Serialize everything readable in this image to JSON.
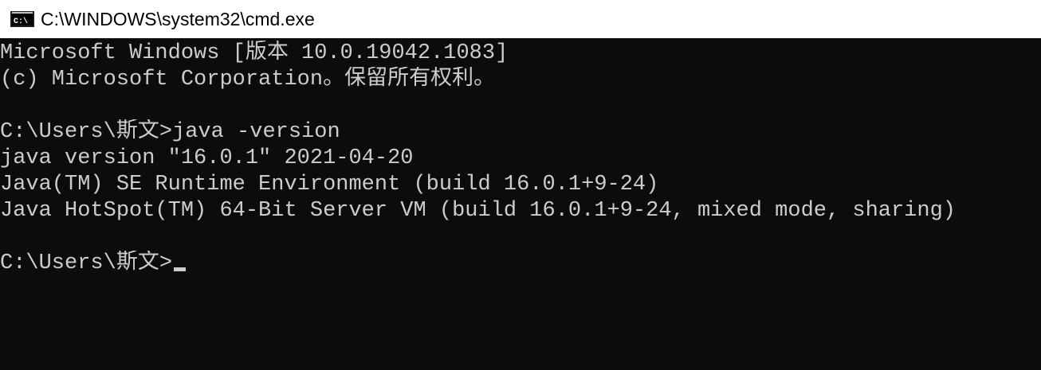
{
  "window": {
    "title": "C:\\WINDOWS\\system32\\cmd.exe",
    "icon": "cmd-icon"
  },
  "console": {
    "lines": [
      "Microsoft Windows [版本 10.0.19042.1083]",
      "(c) Microsoft Corporation。保留所有权利。",
      "",
      "C:\\Users\\斯文>java -version",
      "java version \"16.0.1\" 2021-04-20",
      "Java(TM) SE Runtime Environment (build 16.0.1+9-24)",
      "Java HotSpot(TM) 64-Bit Server VM (build 16.0.1+9-24, mixed mode, sharing)",
      "",
      "C:\\Users\\斯文>"
    ]
  },
  "colors": {
    "background": "#0c0c0c",
    "text": "#cccccc",
    "titlebar": "#ffffff"
  }
}
